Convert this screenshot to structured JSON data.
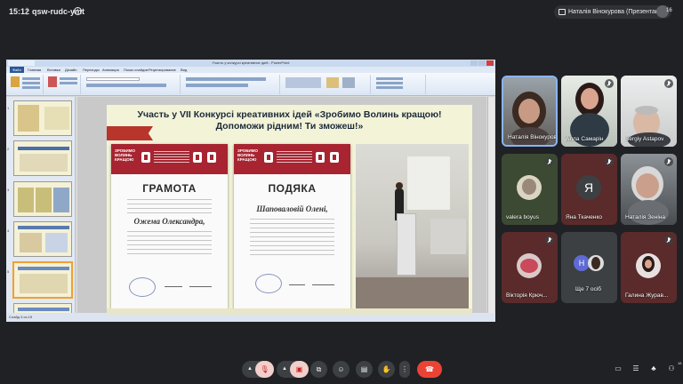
{
  "topbar": {
    "time": "15:12",
    "separator": "|",
    "meeting_code": "qsw-rudc-ymt",
    "presenter_chip": "Наталія Вінокурова (Презентація)",
    "participant_count": "16"
  },
  "shared_screen": {
    "window_title": "Участь у конкурсі креативних ідей - PowerPoint",
    "ribbon_tabs": [
      "Файл",
      "Главная",
      "Вставка",
      "Дизайн",
      "Переходы",
      "Анимация",
      "Показ слайдов",
      "Рецензирование",
      "Вид"
    ],
    "slide": {
      "title_line1": "Участь у VII Конкурсі креативних ідей «Зробимо Волинь кращою!",
      "title_line2": "Допоможи рідним! Ти зможеш!»",
      "cert1": {
        "heading": "ГРАМОТА",
        "name": "Ожема Олександра,"
      },
      "cert2": {
        "heading": "ПОДЯКА",
        "name": "Шаповаловій Олені,"
      }
    },
    "statusbar": "Слайд 3 из 15"
  },
  "participants": [
    {
      "name": "Наталія Вінокурова",
      "muted": false
    },
    {
      "name": "Алла Самарін",
      "muted": true
    },
    {
      "name": "Sergiy Astapov",
      "muted": true
    },
    {
      "name": "valera boyus",
      "muted": true
    },
    {
      "name": "Яна Ткаченко",
      "muted": true,
      "initial": "Я"
    },
    {
      "name": "Наталія Зеніна",
      "muted": true
    },
    {
      "name": "Вікторія Крюч...",
      "muted": true
    },
    {
      "name": "Ще 7 осіб",
      "muted": false,
      "initial": "Н"
    },
    {
      "name": "Галина Журав...",
      "muted": true
    }
  ],
  "colors": {
    "background": "#202124",
    "tile_red": "#5b2b2b",
    "tile_green": "#3d4a33",
    "hangup": "#ea4335"
  },
  "controls": {
    "mic": "mic-off-icon",
    "camera": "camera-off-icon",
    "captions": "captions-icon",
    "emoji": "emoji-icon",
    "present": "present-icon",
    "raise_hand": "hand-icon",
    "more": "more-icon",
    "hangup": "hangup-icon"
  }
}
